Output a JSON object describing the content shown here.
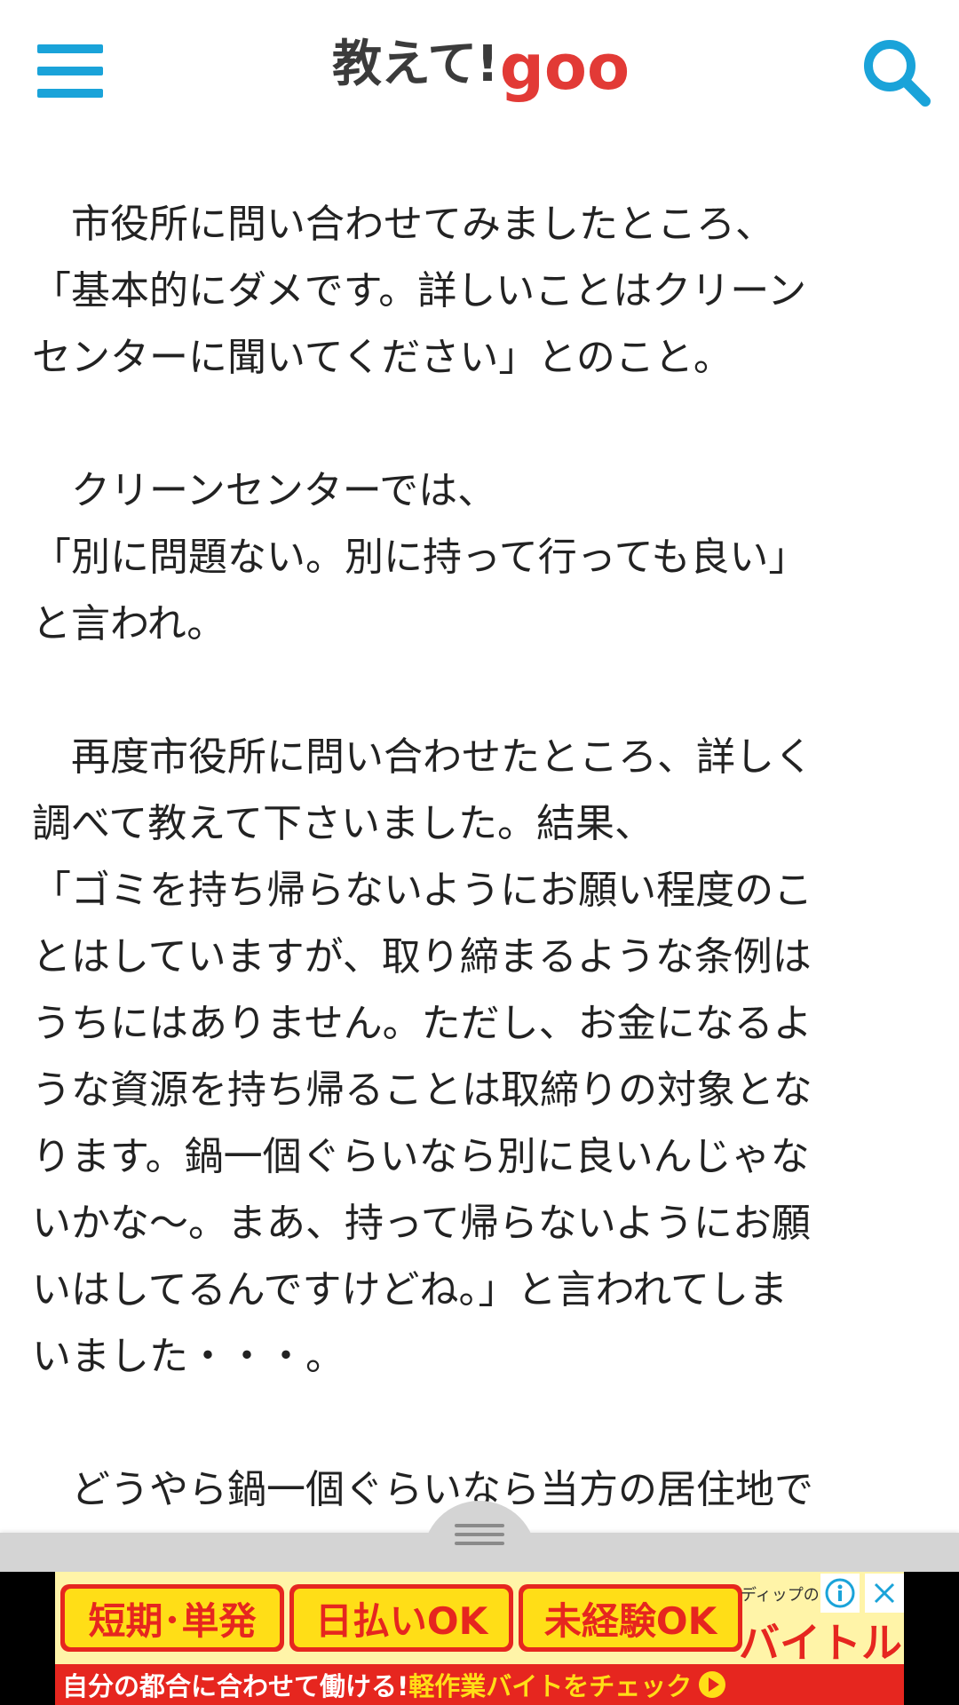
{
  "header": {
    "logo_main": "教えて!",
    "logo_goo": "goo",
    "colors": {
      "icon": "#1aa3d9",
      "logo_text": "#3b3b3b",
      "logo_goo": "#e23a36"
    }
  },
  "article": {
    "paragraphs": [
      {
        "lines": [
          "　市役所に問い合わせてみましたところ、",
          "「基本的にダメです。詳しいことはクリーン",
          "センターに聞いてください」とのこと。"
        ]
      },
      {
        "lines": [
          "　クリーンセンターでは、",
          "「別に問題ない。別に持って行っても良い」",
          "と言われ。"
        ]
      },
      {
        "lines": [
          "　再度市役所に問い合わせたところ、詳しく",
          "調べて教えて下さいました。結果、",
          "「ゴミを持ち帰らないようにお願い程度のこ",
          "とはしていますが、取り締まるような条例は",
          "うちにはありません。ただし、お金になるよ",
          "うな資源を持ち帰ることは取締りの対象とな",
          "ります。鍋一個ぐらいなら別に良いんじゃな",
          "いかな〜。まあ、持って帰らないようにお願",
          "いはしてるんですけどね。」と言われてしま",
          "いました・・・。"
        ]
      },
      {
        "lines": [
          "　どうやら鍋一個ぐらいなら当方の居住地で"
        ]
      }
    ]
  },
  "ad": {
    "chip1": "短期･単発",
    "chip2": "日払いOK",
    "chip3": "未経験OK",
    "brand_small": "ディップの",
    "brand": "バイトル",
    "strip_left": "自分の都合に合わせて働ける!",
    "strip_right": "軽作業バイトをチェック",
    "info_icon": "info-icon",
    "close_icon": "close-icon",
    "colors": {
      "red": "#e6261f",
      "yellow": "#ffde17",
      "bg": "#fff4a8"
    }
  }
}
